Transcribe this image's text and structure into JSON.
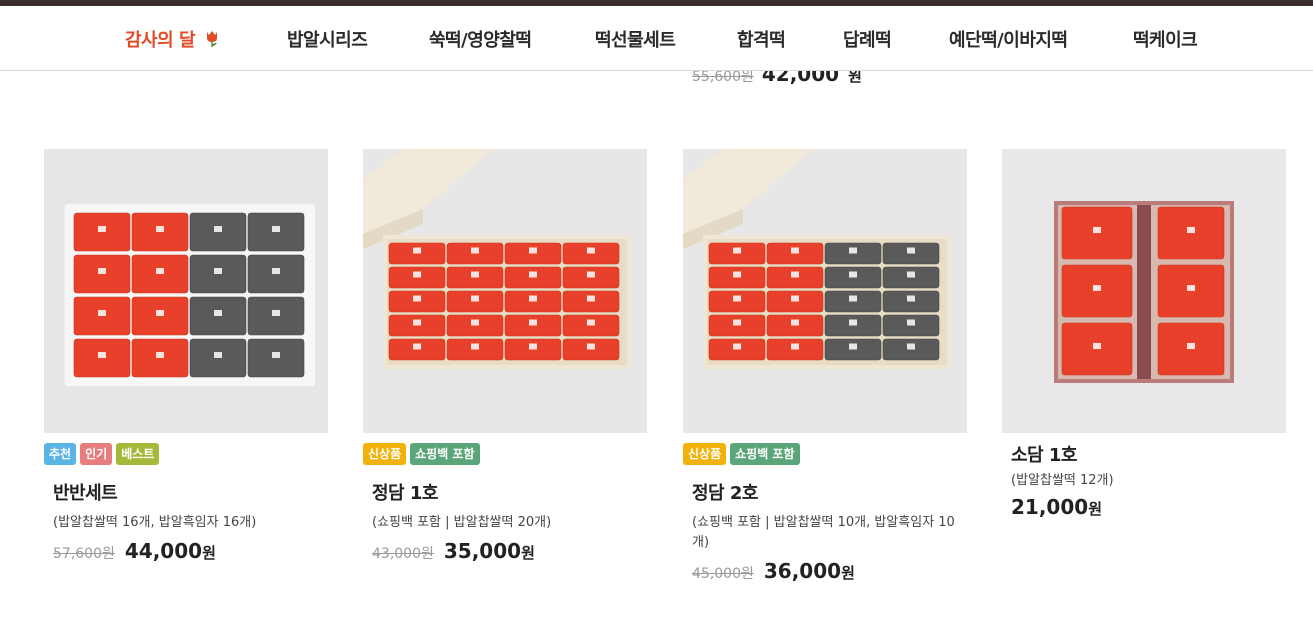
{
  "nav": {
    "items": [
      {
        "label": "감사의 달",
        "active": true,
        "icon": "tulip-icon"
      },
      {
        "label": "밥알시리즈"
      },
      {
        "label": "쑥떡/영양찰떡"
      },
      {
        "label": "떡선물세트"
      },
      {
        "label": "합격떡"
      },
      {
        "label": "답례떡"
      },
      {
        "label": "예단떡/이바지떡"
      },
      {
        "label": "떡케이크"
      }
    ]
  },
  "ghost": {
    "old_price": "55,600원",
    "price": "42,000",
    "won": "원"
  },
  "products": [
    {
      "badges": [
        {
          "label": "추천",
          "color": "#5ab4e6"
        },
        {
          "label": "인기",
          "color": "#e87d7d"
        },
        {
          "label": "베스트",
          "color": "#a6b83a"
        }
      ],
      "name": "반반세트",
      "desc": "(밥알찹쌀떡 16개, 밥알흑임자 16개)",
      "old_price": "57,600원",
      "price": "44,000",
      "won": "원"
    },
    {
      "badges": [
        {
          "label": "신상품",
          "color": "#f3b20a"
        },
        {
          "label": "쇼핑백 포함",
          "color": "#5aa67a"
        }
      ],
      "name": "정담 1호",
      "desc": "(쇼핑백 포함 | 밥알찹쌀떡 20개)",
      "old_price": "43,000원",
      "price": "35,000",
      "won": "원"
    },
    {
      "badges": [
        {
          "label": "신상품",
          "color": "#f3b20a"
        },
        {
          "label": "쇼핑백 포함",
          "color": "#5aa67a"
        }
      ],
      "name": "정담 2호",
      "desc": "(쇼핑백 포함 | 밥알찹쌀떡 10개, 밥알흑임자 10개)",
      "old_price": "45,000원",
      "price": "36,000",
      "won": "원"
    },
    {
      "badges": [],
      "name": "소담 1호",
      "desc": "(밥알찹쌀떡 12개)",
      "old_price": "",
      "price": "21,000",
      "won": "원"
    }
  ],
  "colors": {
    "accent": "#e24b26",
    "topbar": "#3b2c2c",
    "rice_cake_red": "#e8402a",
    "rice_cake_dark": "#5a5a5a"
  }
}
